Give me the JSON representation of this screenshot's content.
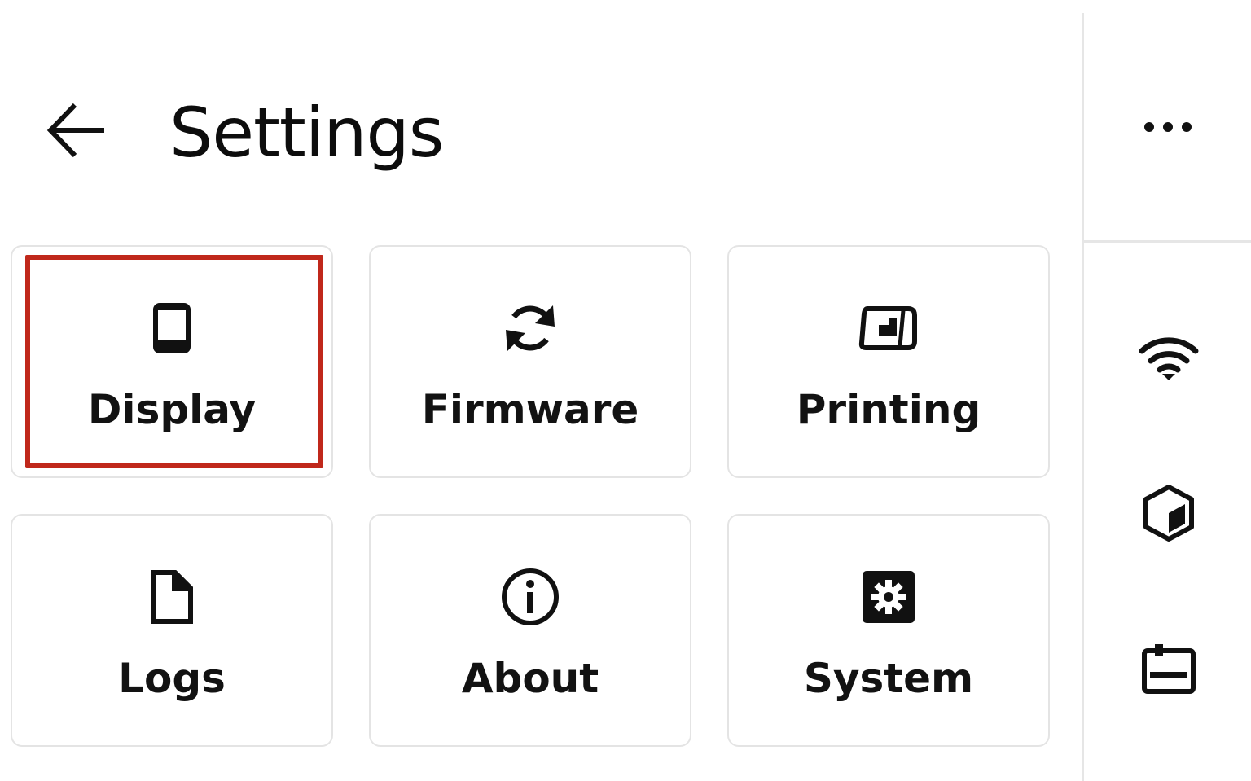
{
  "header": {
    "title": "Settings",
    "back_icon": "arrow-left-icon"
  },
  "tiles": [
    {
      "label": "Display",
      "icon": "tablet-icon",
      "selected": true
    },
    {
      "label": "Firmware",
      "icon": "refresh-icon",
      "selected": false
    },
    {
      "label": "Printing",
      "icon": "printer-tray-icon",
      "selected": false
    },
    {
      "label": "Logs",
      "icon": "file-icon",
      "selected": false
    },
    {
      "label": "About",
      "icon": "info-icon",
      "selected": false
    },
    {
      "label": "System",
      "icon": "gear-icon",
      "selected": false
    }
  ],
  "side_toolbar": {
    "items": [
      "more-options-icon",
      "wifi-icon",
      "cube-icon",
      "printer-status-icon"
    ]
  },
  "colors": {
    "selection_border": "#c0281b",
    "tile_border": "#e4e4e4",
    "text": "#111111",
    "divider": "#e6e6e6"
  }
}
